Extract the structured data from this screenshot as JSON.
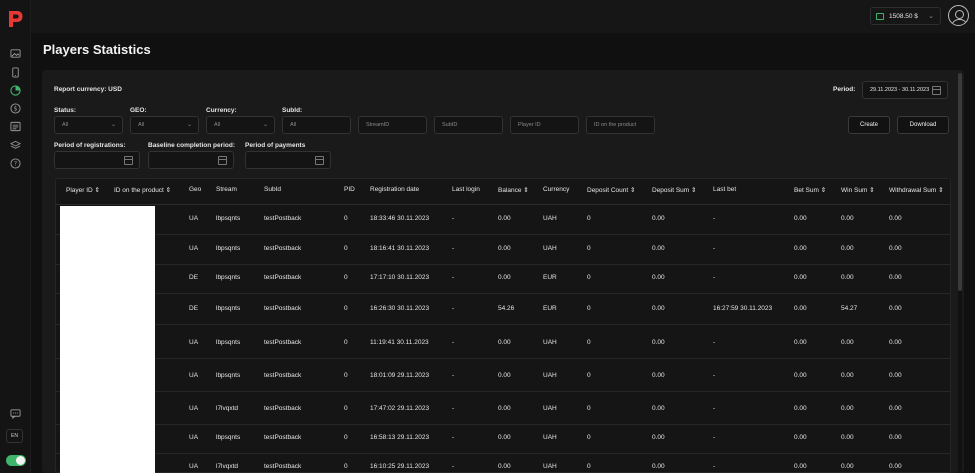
{
  "app": {
    "logo": "P",
    "balance": "1508.50 $",
    "lang": "EN"
  },
  "page": {
    "title": "Players Statistics"
  },
  "filters": {
    "report_currency": "Report currency: USD",
    "period_label": "Period:",
    "period_value": "29.11.2023 - 30.11.2023",
    "status_label": "Status:",
    "status_value": "All",
    "geo_label": "GEO:",
    "geo_value": "All",
    "currency_label": "Currency:",
    "currency_value": "All",
    "subid_label": "SubId:",
    "subid_placeholder": "All",
    "streamid_placeholder": "StreamID",
    "subid2_placeholder": "SubID",
    "playerid_placeholder": "Player ID",
    "idproduct_placeholder": "ID on the product",
    "registrations_label": "Period of registrations:",
    "baseline_label": "Baseline completion period:",
    "payments_label": "Period of payments",
    "create_label": "Create",
    "download_label": "Download"
  },
  "table": {
    "columns": [
      "Player ID",
      "ID on the product",
      "Geo",
      "Stream",
      "SubId",
      "PID",
      "Registration date",
      "Last login",
      "Balance",
      "Currency",
      "Deposit Count",
      "Deposit Sum",
      "Last bet",
      "Bet Sum",
      "Win Sum",
      "Withdrawal Sum"
    ],
    "sortable": [
      true,
      true,
      false,
      false,
      false,
      false,
      false,
      false,
      true,
      false,
      true,
      true,
      false,
      true,
      true,
      true
    ],
    "rows": [
      {
        "geo": "UA",
        "stream": "lbpsqnts",
        "subid": "testPostback",
        "pid": "0",
        "reg": "18:33:46 30.11.2023",
        "login": "-",
        "balance": "0.00",
        "currency": "UAH",
        "dep_count": "0",
        "dep_sum": "0.00",
        "last_bet": "-",
        "bet_sum": "0.00",
        "win_sum": "0.00",
        "withdrawal": "0.00"
      },
      {
        "geo": "UA",
        "stream": "lbpsqnts",
        "subid": "testPostback",
        "pid": "0",
        "reg": "18:16:41 30.11.2023",
        "login": "-",
        "balance": "0.00",
        "currency": "UAH",
        "dep_count": "0",
        "dep_sum": "0.00",
        "last_bet": "-",
        "bet_sum": "0.00",
        "win_sum": "0.00",
        "withdrawal": "0.00"
      },
      {
        "geo": "DE",
        "stream": "lbpsqnts",
        "subid": "testPostback",
        "pid": "0",
        "reg": "17:17:10 30.11.2023",
        "login": "-",
        "balance": "0.00",
        "currency": "EUR",
        "dep_count": "0",
        "dep_sum": "0.00",
        "last_bet": "-",
        "bet_sum": "0.00",
        "win_sum": "0.00",
        "withdrawal": "0.00"
      },
      {
        "geo": "DE",
        "stream": "lbpsqnts",
        "subid": "testPostback",
        "pid": "0",
        "reg": "16:26:30 30.11.2023",
        "login": "-",
        "balance": "54.26",
        "currency": "EUR",
        "dep_count": "0",
        "dep_sum": "0.00",
        "last_bet": "16:27:59 30.11.2023",
        "bet_sum": "0.00",
        "win_sum": "54.27",
        "withdrawal": "0.00"
      },
      {
        "geo": "UA",
        "stream": "lbpsqnts",
        "subid": "testPostback",
        "pid": "0",
        "reg": "11:19:41 30.11.2023",
        "login": "-",
        "balance": "0.00",
        "currency": "UAH",
        "dep_count": "0",
        "dep_sum": "0.00",
        "last_bet": "-",
        "bet_sum": "0.00",
        "win_sum": "0.00",
        "withdrawal": "0.00"
      },
      {
        "geo": "UA",
        "stream": "lbpsqnts",
        "subid": "testPostback",
        "pid": "0",
        "reg": "18:01:09 29.11.2023",
        "login": "-",
        "balance": "0.00",
        "currency": "UAH",
        "dep_count": "0",
        "dep_sum": "0.00",
        "last_bet": "-",
        "bet_sum": "0.00",
        "win_sum": "0.00",
        "withdrawal": "0.00"
      },
      {
        "geo": "UA",
        "stream": "l7lvqxtd",
        "subid": "testPostback",
        "pid": "0",
        "reg": "17:47:02 29.11.2023",
        "login": "-",
        "balance": "0.00",
        "currency": "UAH",
        "dep_count": "0",
        "dep_sum": "0.00",
        "last_bet": "-",
        "bet_sum": "0.00",
        "win_sum": "0.00",
        "withdrawal": "0.00"
      },
      {
        "geo": "UA",
        "stream": "lbpsqnts",
        "subid": "testPostback",
        "pid": "0",
        "reg": "16:58:13 29.11.2023",
        "login": "-",
        "balance": "0.00",
        "currency": "UAH",
        "dep_count": "0",
        "dep_sum": "0.00",
        "last_bet": "-",
        "bet_sum": "0.00",
        "win_sum": "0.00",
        "withdrawal": "0.00"
      },
      {
        "geo": "UA",
        "stream": "l7lvqxtd",
        "subid": "testPostback",
        "pid": "0",
        "reg": "16:10:25 29.11.2023",
        "login": "-",
        "balance": "0.00",
        "currency": "UAH",
        "dep_count": "0",
        "dep_sum": "0.00",
        "last_bet": "-",
        "bet_sum": "0.00",
        "win_sum": "0.00",
        "withdrawal": "0.00"
      }
    ]
  },
  "colors": {
    "brand": "#e53935",
    "accent": "#3fb56b",
    "background": "#101010",
    "panel": "#1a1a1a"
  }
}
